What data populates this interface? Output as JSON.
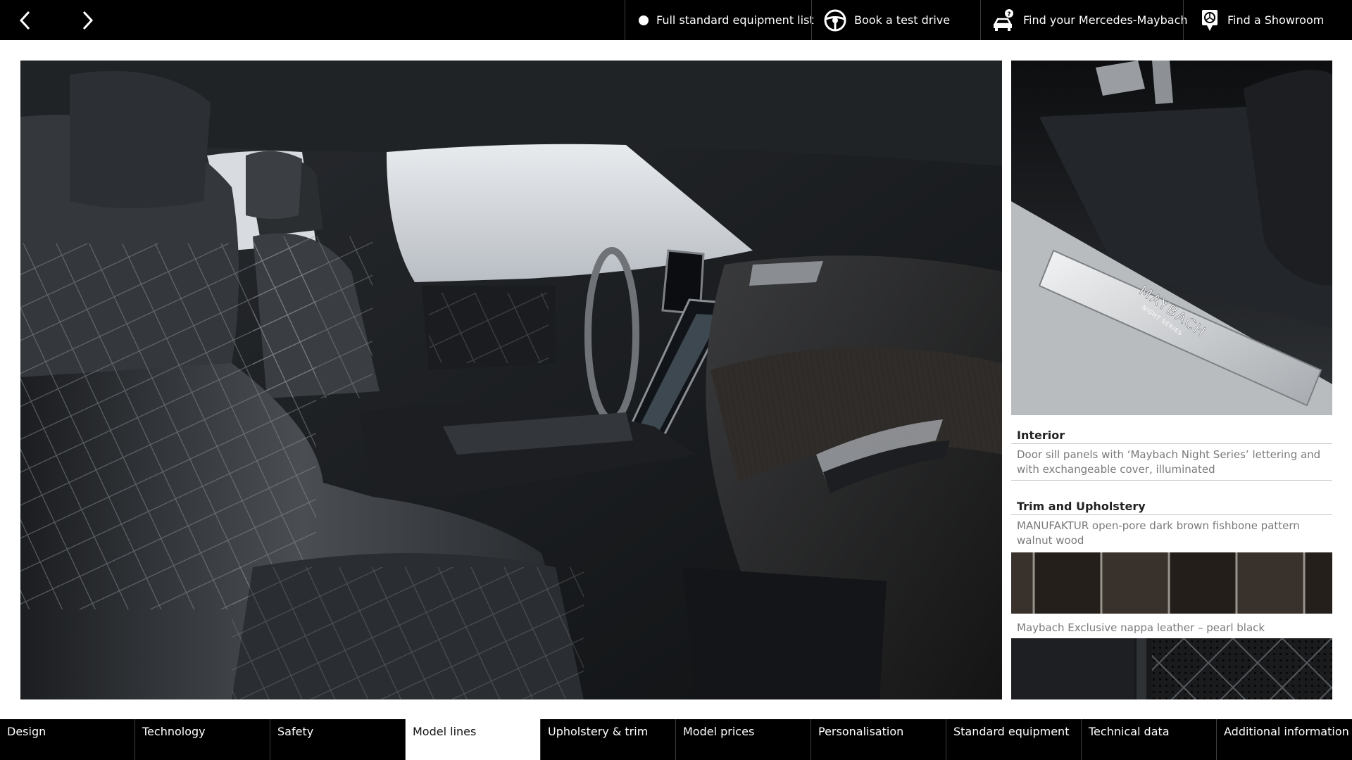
{
  "header": {
    "prev_icon": "chevron-left-icon",
    "next_icon": "chevron-right-icon",
    "links": [
      {
        "icon": "dot-icon",
        "label": "Full standard equipment list"
      },
      {
        "icon": "steering-wheel-icon",
        "label": "Book a test drive"
      },
      {
        "icon": "car-question-icon",
        "label": "Find your Mercedes-Maybach"
      },
      {
        "icon": "location-pin-icon",
        "label": "Find a Showroom"
      }
    ]
  },
  "door_sill_lettering": "MAYBACH",
  "door_sill_sublettering": "NIGHT SERIES",
  "interior": {
    "title": "Interior",
    "text": "Door sill panels with ‘Maybach Night Series’ lettering and with exchangeable cover, illuminated"
  },
  "trim": {
    "title": "Trim and Upholstery",
    "wood_text": "MANUFAKTUR open-pore dark brown fishbone pattern walnut wood",
    "leather_text": "Maybach Exclusive nappa leather – pearl black"
  },
  "bottom_nav": {
    "active": "Model lines",
    "items": [
      "Design",
      "Technology",
      "Safety",
      "Model lines",
      "Upholstery & trim",
      "Model prices",
      "Personalisation",
      "Standard equipment",
      "Technical data",
      "Additional information"
    ]
  },
  "colors": {
    "bar_background": "#000000",
    "active_tab_background": "#ffffff",
    "muted_text": "#7a7a7a"
  }
}
